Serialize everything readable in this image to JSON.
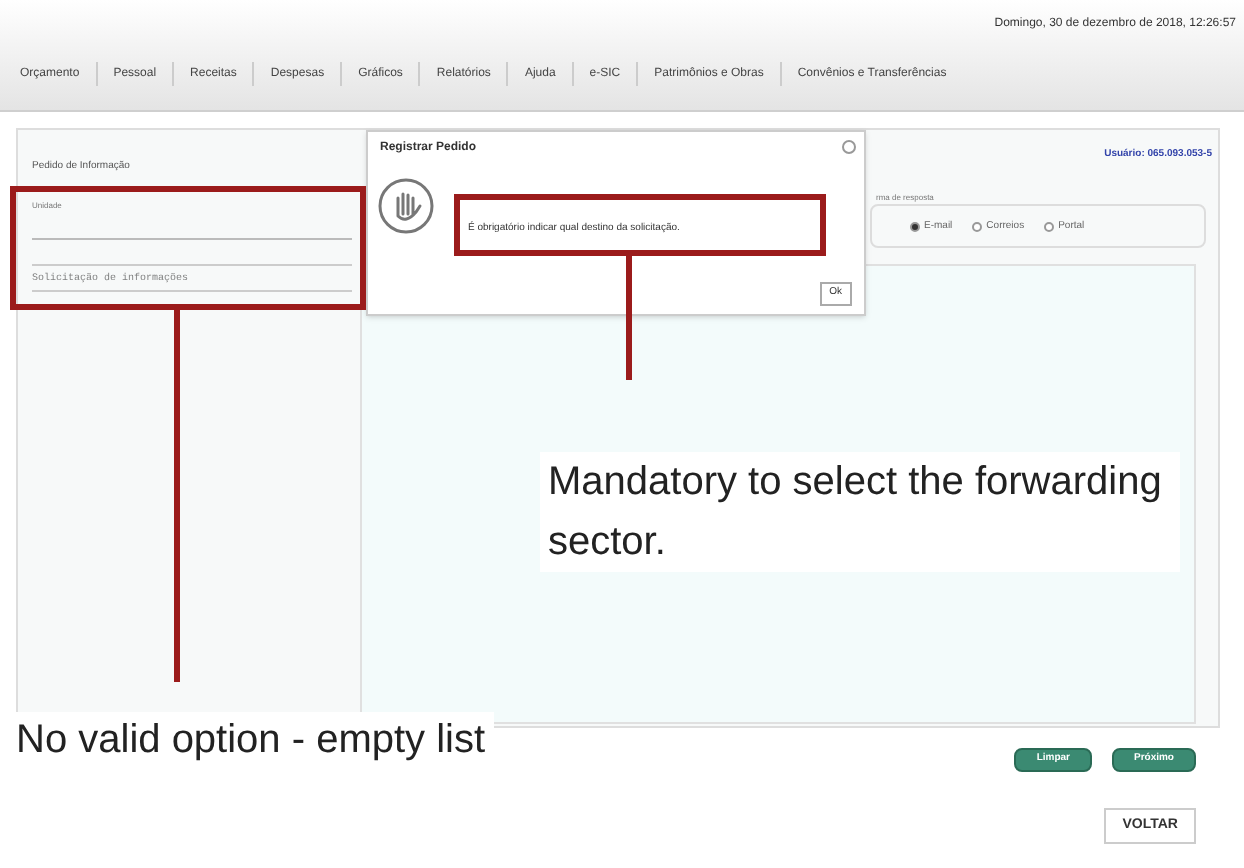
{
  "header": {
    "date": "Domingo, 30 de dezembro de 2018, 12:26:57",
    "nav": [
      "Orçamento",
      "Pessoal",
      "Receitas",
      "Despesas",
      "Gráficos",
      "Relatórios",
      "Ajuda",
      "e-SIC",
      "Patrimônios e Obras",
      "Convênios e Transferências"
    ]
  },
  "form": {
    "title": "Pedido de Informação",
    "field_label": "Unidade",
    "subject_placeholder": "Solicitação de informações",
    "user": "Usuário: 065.093.053-5",
    "response_label": "rma de resposta",
    "response_options": [
      {
        "label": "E-mail",
        "selected": true
      },
      {
        "label": "Correios",
        "selected": false
      },
      {
        "label": "Portal",
        "selected": false
      }
    ],
    "buttons": [
      "Limpar",
      "Próximo"
    ],
    "back_button": "VOLTAR"
  },
  "dialog": {
    "title": "Registrar Pedido",
    "message": "É obrigatório indicar qual destino da solicitação.",
    "ok_button": "Ok"
  },
  "annotations": [
    "Mandatory to select the forwarding sector.",
    "No valid option - empty list"
  ]
}
